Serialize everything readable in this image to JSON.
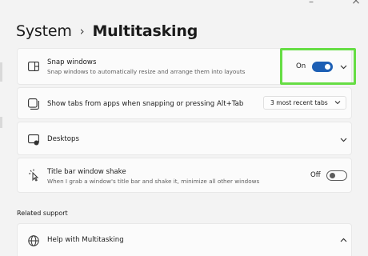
{
  "window": {
    "minimize_glyph": "–",
    "close_glyph": "×"
  },
  "breadcrumb": {
    "parent": "System",
    "separator": "›",
    "current": "Multitasking"
  },
  "rows": {
    "snap": {
      "icon": "snap-windows-icon",
      "title": "Snap windows",
      "subtitle": "Snap windows to automatically resize and arrange them into layouts",
      "toggle_label": "On",
      "toggle_state": "on"
    },
    "tabs": {
      "icon": "tabs-windows-icon",
      "title": "Show tabs from apps when snapping or pressing Alt+Tab",
      "dropdown_value": "3 most recent tabs"
    },
    "desktops": {
      "icon": "desktops-icon",
      "title": "Desktops"
    },
    "shake": {
      "icon": "title-bar-shake-icon",
      "title": "Title bar window shake",
      "subtitle": "When I grab a window's title bar and shake it, minimize all other windows",
      "toggle_label": "Off",
      "toggle_state": "off"
    }
  },
  "related": {
    "section_title": "Related support",
    "help_title": "Help with Multitasking",
    "help_icon": "globe-icon"
  },
  "colors": {
    "accent": "#1d5fb4",
    "highlight": "#66dd44",
    "background": "#f3f3f3",
    "card": "#fbfbfb"
  }
}
